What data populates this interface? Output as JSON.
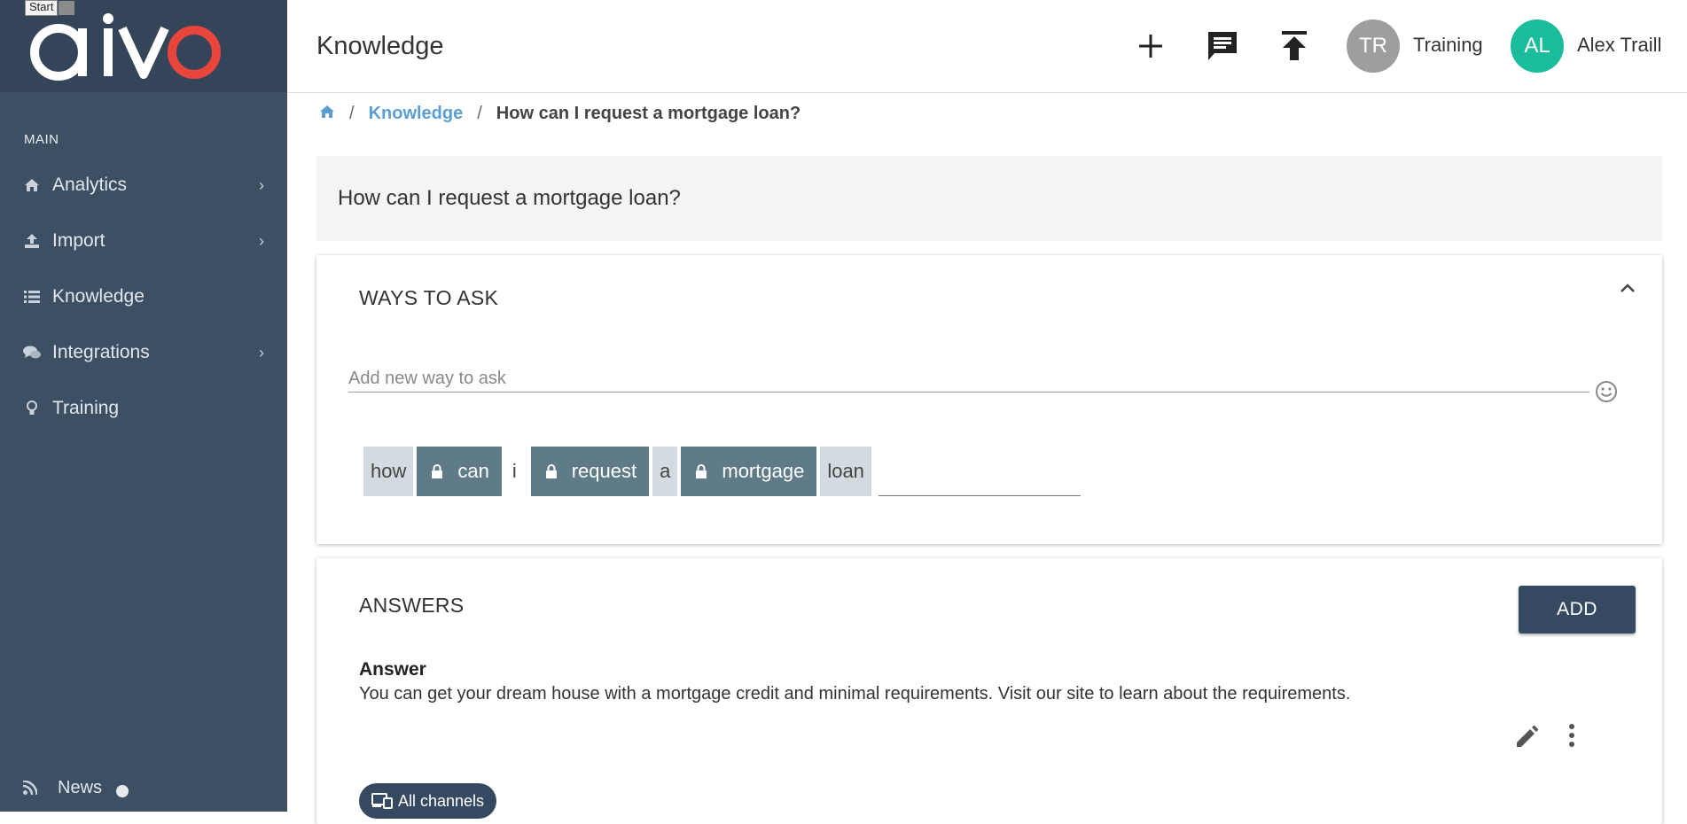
{
  "tooltip": {
    "start": "Start"
  },
  "logo": {
    "text": "aivo",
    "accent": "#e8453c"
  },
  "sidebar": {
    "section_label": "MAIN",
    "items": [
      {
        "label": "Analytics",
        "icon": "home-icon",
        "has_submenu": true
      },
      {
        "label": "Import",
        "icon": "upload-icon",
        "has_submenu": true
      },
      {
        "label": "Knowledge",
        "icon": "list-icon",
        "has_submenu": false
      },
      {
        "label": "Integrations",
        "icon": "chat-bubbles-icon",
        "has_submenu": true
      },
      {
        "label": "Training",
        "icon": "lightbulb-icon",
        "has_submenu": false
      }
    ],
    "news_label": "News"
  },
  "header": {
    "title": "Knowledge",
    "training_avatar": "TR",
    "training_label": "Training",
    "user_avatar": "AL",
    "user_name": "Alex Traill",
    "user_avatar_color": "#1abc9c"
  },
  "breadcrumb": {
    "section": "Knowledge",
    "current": "How can I request a mortgage loan?"
  },
  "question": {
    "text": "How can I request a mortgage loan?"
  },
  "ways_to_ask": {
    "title": "WAYS TO ASK",
    "input_placeholder": "Add new way to ask",
    "tokens": [
      {
        "text": "how",
        "locked": false
      },
      {
        "text": "can",
        "locked": true
      },
      {
        "text": "i",
        "locked": false,
        "bare": true
      },
      {
        "text": "request",
        "locked": true
      },
      {
        "text": "a",
        "locked": false
      },
      {
        "text": "mortgage",
        "locked": true
      },
      {
        "text": "loan",
        "locked": false
      }
    ]
  },
  "answers": {
    "title": "ANSWERS",
    "add_label": "ADD",
    "answer_label": "Answer",
    "answer_text": "You can get your dream house with a mortgage credit and minimal requirements. Visit our site to learn about the requirements.",
    "channel_label": "All channels"
  }
}
